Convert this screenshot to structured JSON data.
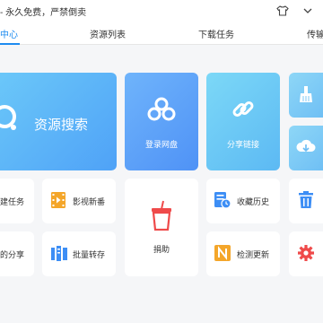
{
  "titlebar": {
    "title": "- 永久免费，严禁倒卖"
  },
  "tabs": [
    {
      "label": "中心"
    },
    {
      "label": "资源列表"
    },
    {
      "label": "下载任务"
    },
    {
      "label": "传输"
    }
  ],
  "tiles": {
    "search": "资源搜索",
    "pan": "登录网盘",
    "share": "分享链接",
    "task": "建任务",
    "movies": "影视新番",
    "donate": "捐助",
    "history": "收藏历史",
    "my_share": "的分享",
    "batch": "批量转存",
    "update": "检测更新"
  },
  "colors": {
    "accent": "#1e8cf0",
    "orange": "#f4a62a",
    "red": "#ef4a4a",
    "purple": "#7b6ff2",
    "blue": "#3d8ef5"
  }
}
